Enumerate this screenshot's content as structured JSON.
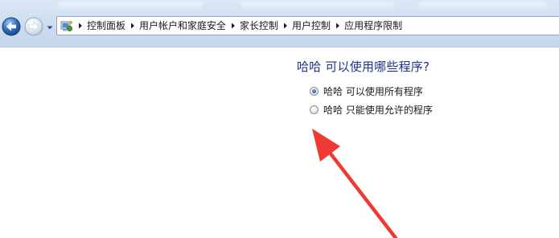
{
  "address_bar": {
    "breadcrumbs": [
      {
        "label": "控制面板"
      },
      {
        "label": "用户帐户和家庭安全"
      },
      {
        "label": "家长控制"
      },
      {
        "label": "用户控制"
      },
      {
        "label": "应用程序限制"
      }
    ]
  },
  "main": {
    "question": "哈哈 可以使用哪些程序?",
    "options": [
      {
        "label": "哈哈 可以使用所有程序",
        "selected": true
      },
      {
        "label": "哈哈 只能使用允许的程序",
        "selected": false
      }
    ]
  },
  "annotation": {
    "arrow_color": "#ee3a33"
  },
  "icons": {
    "back": "back-arrow-icon",
    "forward": "forward-arrow-icon",
    "history": "chevron-down-icon",
    "address": "control-panel-icon",
    "separator": "breadcrumb-chevron-icon"
  },
  "colors": {
    "question_text": "#1e3287",
    "nav_button": "#2f6fc0",
    "navbar_background": "#cddcf0"
  }
}
